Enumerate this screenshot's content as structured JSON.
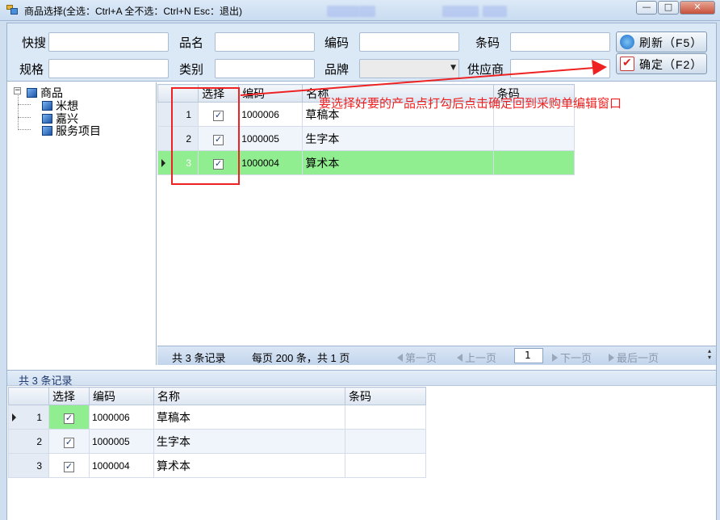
{
  "window": {
    "title": "商品选择(全选：Ctrl+A  全不选：Ctrl+N  Esc：退出)",
    "minimize": "—",
    "maximize": "□",
    "close": "✕"
  },
  "search": {
    "quick_label": "快搜",
    "name_label": "品名",
    "code_label": "编码",
    "barcode_label": "条码",
    "spec_label": "规格",
    "category_label": "类别",
    "brand_label": "品牌",
    "supplier_label": "供应商",
    "refresh_label": "刷新（F5）",
    "confirm_label": "确定（F2）"
  },
  "tree": {
    "root": "商品",
    "children": [
      "米想",
      "嘉兴",
      "服务项目"
    ]
  },
  "grid": {
    "columns": [
      "",
      "选择",
      "编码",
      "名称",
      "条码"
    ],
    "rows": [
      {
        "num": "1",
        "checked": true,
        "code": "1000006",
        "name": "草稿本",
        "barcode": ""
      },
      {
        "num": "2",
        "checked": true,
        "code": "1000005",
        "name": "生字本",
        "barcode": ""
      },
      {
        "num": "3",
        "checked": true,
        "code": "1000004",
        "name": "算术本",
        "barcode": ""
      }
    ]
  },
  "pager": {
    "total": "共 3 条记录",
    "per_page": "每页 200 条，共 1 页",
    "first": "第一页",
    "prev": "上一页",
    "page": "1",
    "next": "下一页",
    "last": "最后一页"
  },
  "selected": {
    "count": "共 3 条记录",
    "columns": [
      "",
      "选择",
      "编码",
      "名称",
      "条码"
    ],
    "rows": [
      {
        "num": "1",
        "checked": true,
        "code": "1000006",
        "name": "草稿本",
        "barcode": ""
      },
      {
        "num": "2",
        "checked": true,
        "code": "1000005",
        "name": "生字本",
        "barcode": ""
      },
      {
        "num": "3",
        "checked": true,
        "code": "1000004",
        "name": "算术本",
        "barcode": ""
      }
    ]
  },
  "annotation": {
    "text": "要选择好要的产品点打勾后点击确定回到采购单编辑窗口",
    "color": "#ee2020"
  },
  "colors": {
    "selected_row": "#90ee90",
    "frame": "#dbe8f6"
  }
}
